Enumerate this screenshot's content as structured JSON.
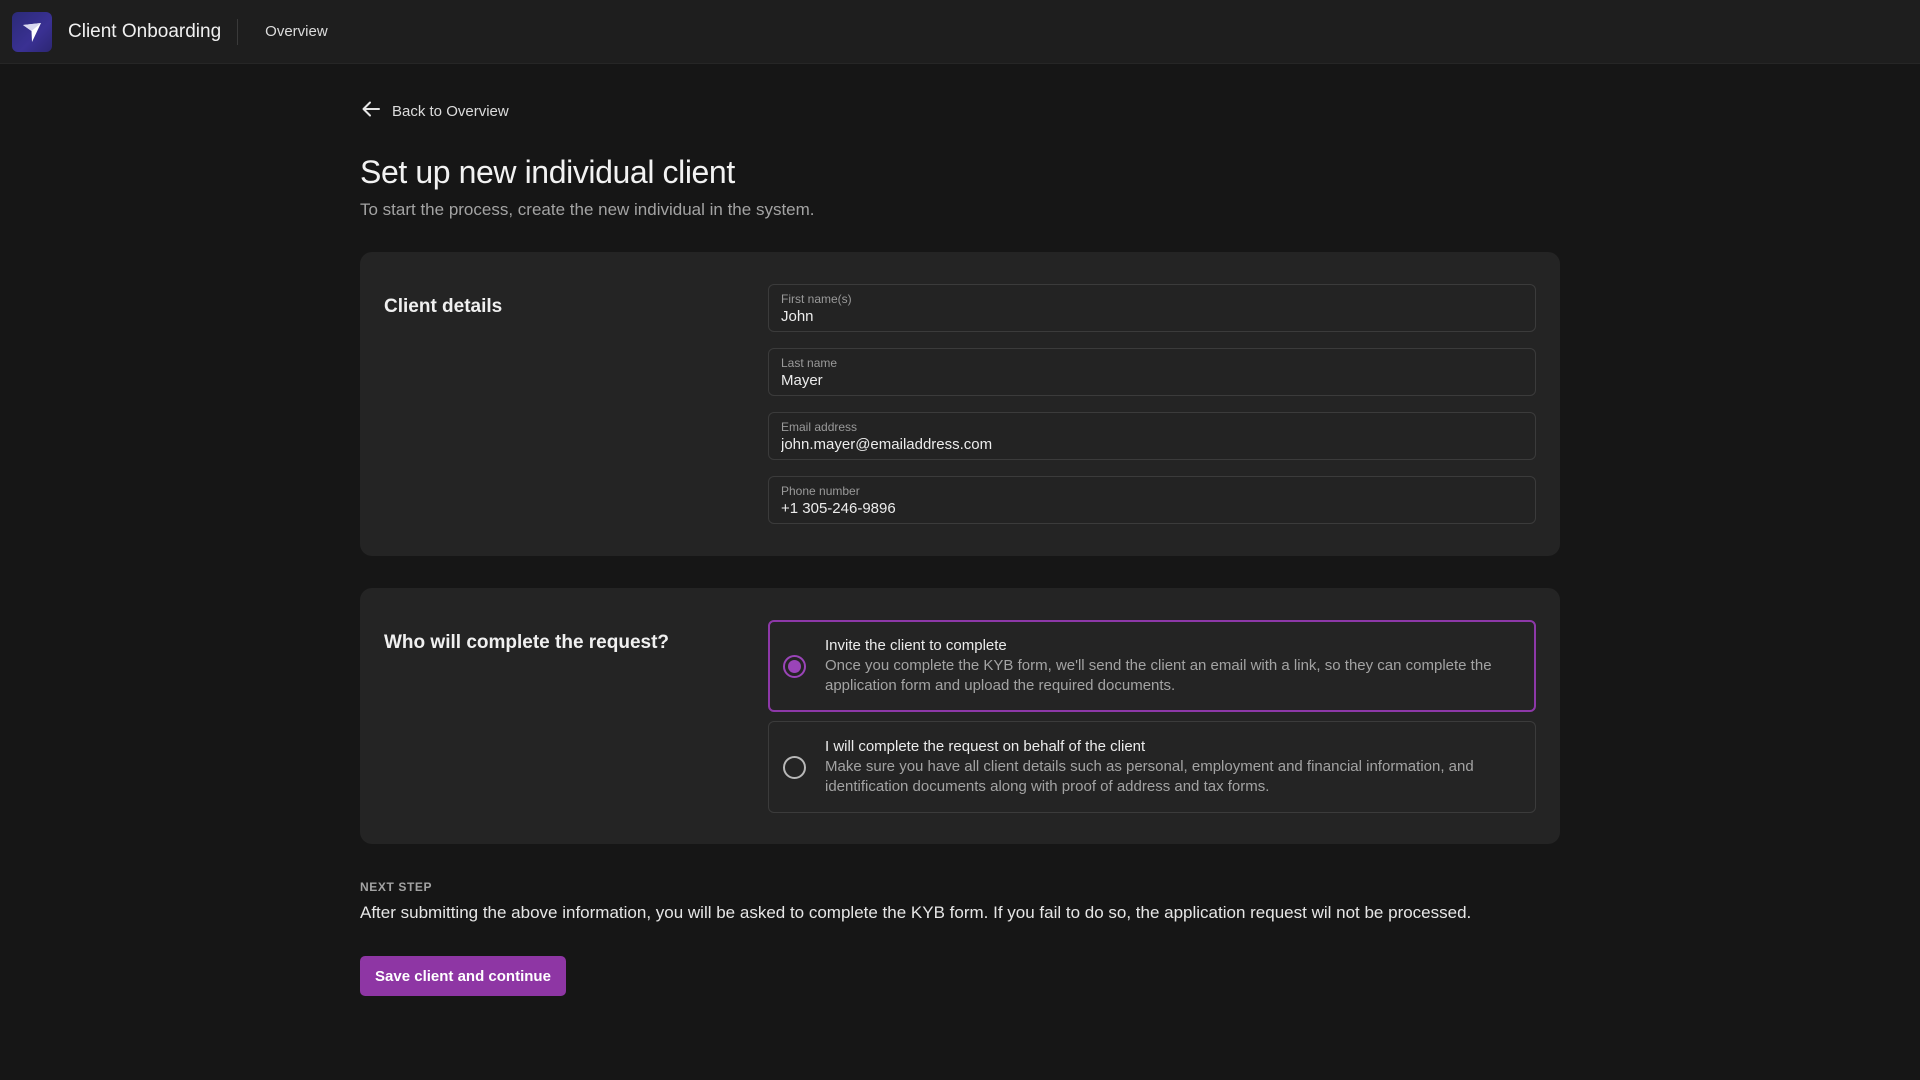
{
  "header": {
    "app_title": "Client Onboarding",
    "nav_overview": "Overview",
    "logo_icon": "paper-plane-logo-icon"
  },
  "back_link": {
    "label": "Back to Overview",
    "icon": "arrow-left-icon"
  },
  "page": {
    "title": "Set up new individual client",
    "subtitle": "To start the process, create the new individual in the system."
  },
  "client_details": {
    "heading": "Client details",
    "fields": [
      {
        "label": "First name(s)",
        "value": "John"
      },
      {
        "label": "Last name",
        "value": "Mayer"
      },
      {
        "label": "Email address",
        "value": "john.mayer@emailaddress.com"
      },
      {
        "label": "Phone number",
        "value": "+1 305-246-9896"
      }
    ]
  },
  "completion": {
    "heading": "Who will complete the request?",
    "selected_index": 0,
    "options": [
      {
        "title": "Invite the client to complete",
        "description": "Once you complete the KYB form, we'll send the client an email with a link, so they can complete the application form and upload the required documents."
      },
      {
        "title": "I will complete the request on behalf of the client",
        "description": "Make sure you have all client details such as personal, employment and financial information, and identification documents along with proof of address and tax forms."
      }
    ]
  },
  "next_step": {
    "kicker": "NEXT STEP",
    "description": "After submitting the above information, you will be asked to complete the KYB form. If you fail to do so, the application request wil not be processed."
  },
  "actions": {
    "primary_label": "Save client and continue"
  },
  "colors": {
    "accent": "#8e36a4",
    "background": "#161616",
    "card": "#242424"
  }
}
